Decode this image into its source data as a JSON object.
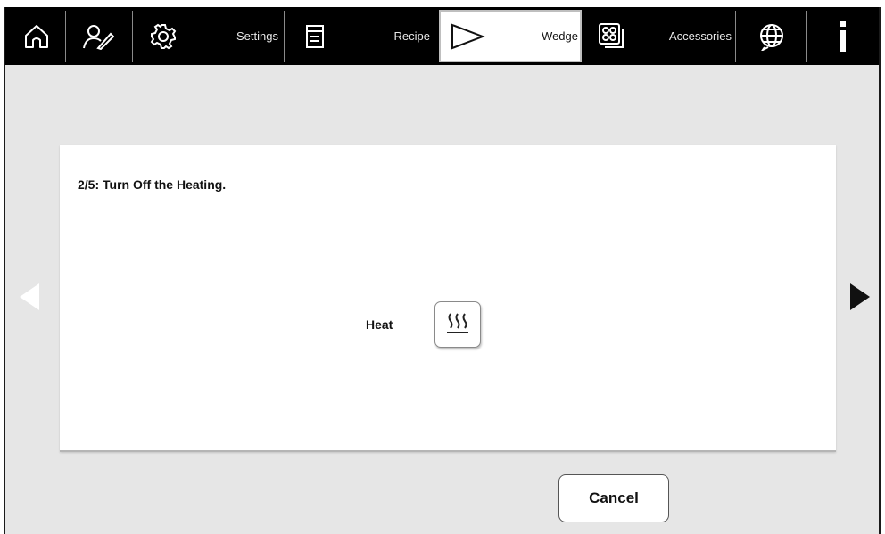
{
  "toolbar": {
    "items": [
      {
        "icon": "home-icon"
      },
      {
        "icon": "user-edit-icon"
      },
      {
        "icon": "gear-icon",
        "label": "Settings"
      },
      {
        "icon": "recipe-icon",
        "label": "Recipe"
      },
      {
        "icon": "wedge-icon",
        "label": "Wedge",
        "active": true
      },
      {
        "icon": "accessories-icon",
        "label": "Accessories"
      },
      {
        "icon": "globe-icon"
      },
      {
        "icon": "info-icon"
      }
    ]
  },
  "step": {
    "title": "2/5: Turn Off the Heating."
  },
  "heat": {
    "label": "Heat",
    "icon": "heat-icon"
  },
  "actions": {
    "cancel_label": "Cancel"
  },
  "colors": {
    "toolbar_bg": "#000000",
    "content_bg": "#e6e6e6",
    "panel_bg": "#ffffff"
  }
}
